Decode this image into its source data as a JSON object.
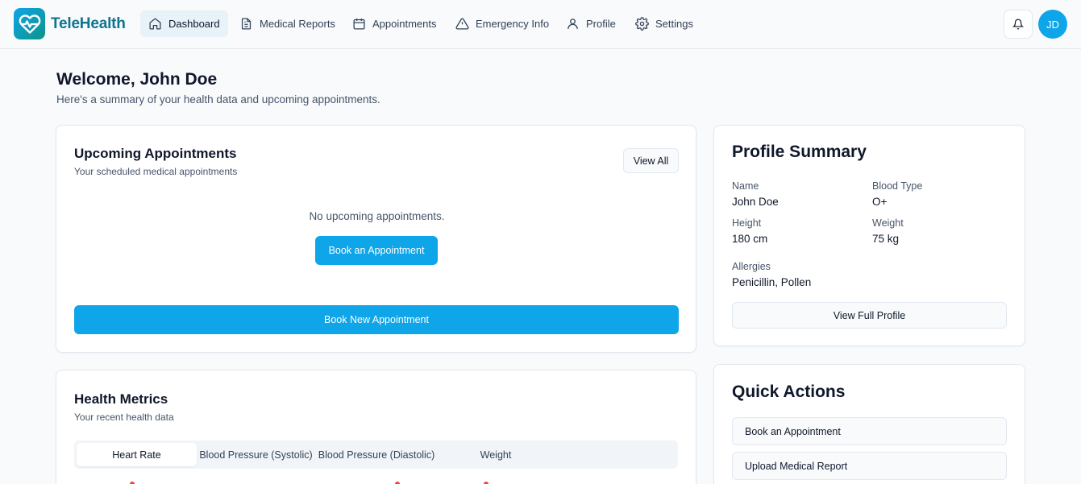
{
  "app": {
    "name": "TeleHealth"
  },
  "nav": [
    {
      "label": "Dashboard",
      "icon": "home-icon",
      "active": true
    },
    {
      "label": "Medical Reports",
      "icon": "file-icon"
    },
    {
      "label": "Appointments",
      "icon": "calendar-icon"
    },
    {
      "label": "Emergency Info",
      "icon": "warning-icon"
    },
    {
      "label": "Profile",
      "icon": "user-icon"
    },
    {
      "label": "Settings",
      "icon": "gear-icon"
    }
  ],
  "header": {
    "avatar_initials": "JD",
    "bell_icon": "bell-icon"
  },
  "welcome": {
    "title": "Welcome, John Doe",
    "subtitle": "Here's a summary of your health data and upcoming appointments."
  },
  "appointments": {
    "title": "Upcoming Appointments",
    "subtitle": "Your scheduled medical appointments",
    "view_all": "View All",
    "empty": "No upcoming appointments.",
    "book": "Book an Appointment",
    "book_new": "Book New Appointment"
  },
  "profile": {
    "title": "Profile Summary",
    "fields": {
      "name_label": "Name",
      "name_value": "John Doe",
      "blood_label": "Blood Type",
      "blood_value": "O+",
      "height_label": "Height",
      "height_value": "180 cm",
      "weight_label": "Weight",
      "weight_value": "75 kg",
      "allergies_label": "Allergies",
      "allergies_value": "Penicillin, Pollen"
    },
    "view_full": "View Full Profile"
  },
  "metrics": {
    "title": "Health Metrics",
    "subtitle": "Your recent health data",
    "tabs": [
      "Heart Rate",
      "Blood Pressure (Systolic)",
      "Blood Pressure (Diastolic)",
      "Weight"
    ],
    "active_tab": 0
  },
  "quick_actions": {
    "title": "Quick Actions",
    "items": [
      "Book an Appointment",
      "Upload Medical Report"
    ]
  },
  "colors": {
    "primary": "#0ea5e9",
    "brand_text": "#0e7490",
    "alert_dot": "#ef4444"
  }
}
